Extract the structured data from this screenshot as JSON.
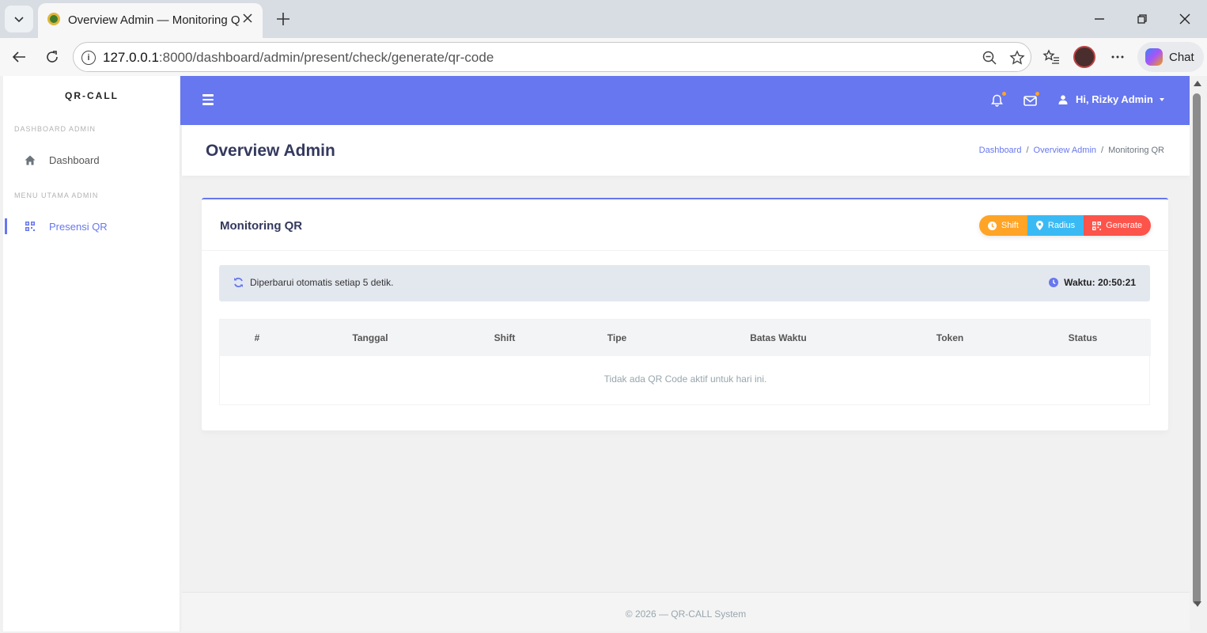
{
  "browser": {
    "tab_title": "Overview Admin — Monitoring QR",
    "url_host": "127.0.0.1",
    "url_rest": ":8000/dashboard/admin/present/check/generate/qr-code",
    "chat_label": "Chat"
  },
  "sidebar": {
    "brand": "QR-CALL",
    "heading_1": "DASHBOARD ADMIN",
    "heading_2": "MENU UTAMA ADMIN",
    "items": [
      {
        "label": "Dashboard",
        "icon": "home-icon",
        "active": false
      },
      {
        "label": "Presensi QR",
        "icon": "qrcode-icon",
        "active": true
      }
    ]
  },
  "topnav": {
    "user_greeting": "Hi, Rizky Admin",
    "accent_color": "#6777ef"
  },
  "header": {
    "title": "Overview Admin",
    "breadcrumb": [
      "Dashboard",
      "Overview Admin",
      "Monitoring QR"
    ]
  },
  "card": {
    "title": "Monitoring QR",
    "buttons": {
      "shift": "Shift",
      "radius": "Radius",
      "generate": "Generate"
    },
    "alert_text": "Diperbarui otomatis setiap 5 detik.",
    "time_text": "Waktu: 20:50:21"
  },
  "table": {
    "columns": [
      "#",
      "Tanggal",
      "Shift",
      "Tipe",
      "Batas Waktu",
      "Token",
      "Status"
    ],
    "empty_text": "Tidak ada QR Code aktif untuk hari ini."
  },
  "footer": {
    "text": "© 2026 — QR-CALL System"
  }
}
